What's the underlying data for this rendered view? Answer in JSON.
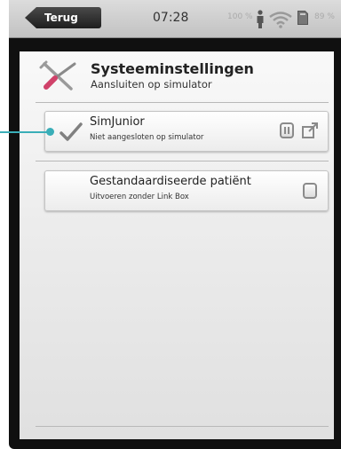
{
  "statusbar": {
    "back_label": "Terug",
    "time": "07:28",
    "battery_left": "100 %",
    "battery_right": "89 %",
    "icons": [
      "person-icon",
      "wifi-icon",
      "sd-card-icon"
    ]
  },
  "header": {
    "title": "Systeeminstellingen",
    "subtitle": "Aansluiten op simulator",
    "icon": "tools-icon"
  },
  "settings": [
    {
      "title": "SimJunior",
      "subtitle": "Niet aangesloten op simulator",
      "checked": true,
      "icons": [
        "toggle-icon",
        "external-link-icon"
      ]
    },
    {
      "title": "Gestandaardiseerde patiënt",
      "subtitle": "Uitvoeren zonder Link Box",
      "checked": false,
      "icons": [
        "toggle-icon"
      ]
    }
  ],
  "colors": {
    "accent_callout": "#3aaeb8",
    "checkmark": "#808080"
  }
}
